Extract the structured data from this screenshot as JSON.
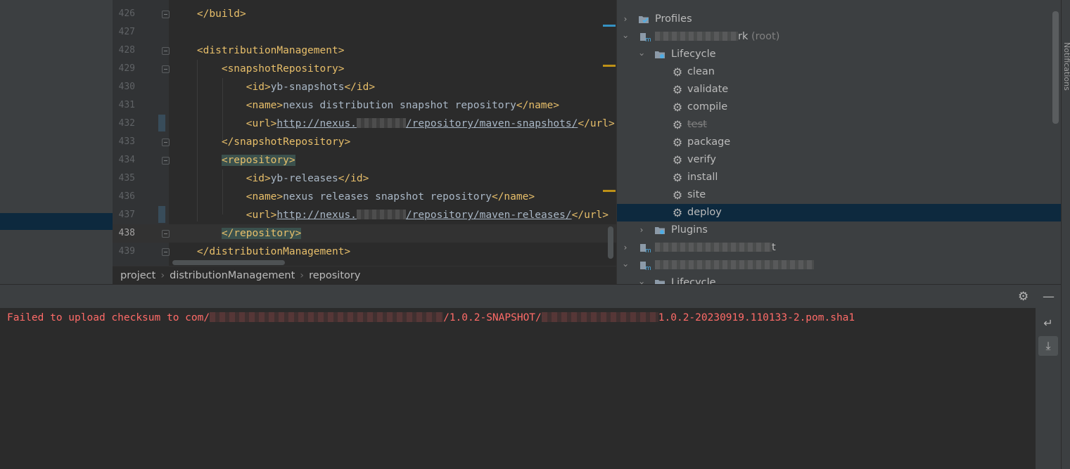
{
  "editor": {
    "lines": [
      {
        "num": "426",
        "segments": [
          {
            "c": "    "
          },
          {
            "c": "</build>"
          }
        ]
      },
      {
        "num": "427",
        "segments": []
      },
      {
        "num": "428",
        "segments": [
          {
            "c": "    "
          },
          {
            "c": "<distributionManagement>"
          }
        ]
      },
      {
        "num": "429",
        "segments": [
          {
            "c": "        "
          },
          {
            "c": "<snapshotRepository>"
          }
        ]
      },
      {
        "num": "430",
        "segments": [
          {
            "c": "            "
          },
          {
            "c": "<id>"
          },
          {
            "t": "yb-snapshots"
          },
          {
            "c": "</id>"
          }
        ]
      },
      {
        "num": "431",
        "segments": [
          {
            "c": "            "
          },
          {
            "c": "<name>"
          },
          {
            "t": "nexus distribution snapshot repository"
          },
          {
            "c": "</name>"
          }
        ]
      },
      {
        "num": "432",
        "segments": [
          {
            "c": "            "
          },
          {
            "c": "<url>"
          },
          {
            "u": "http://nexus."
          },
          {
            "r": "1"
          },
          {
            "u": "/repository/maven-snapshots/"
          },
          {
            "c": "</url>"
          }
        ]
      },
      {
        "num": "433",
        "segments": [
          {
            "c": "        "
          },
          {
            "c": "</snapshotRepository>"
          }
        ]
      },
      {
        "num": "434",
        "segments": [
          {
            "c": "        "
          },
          {
            "h": "<repository>"
          }
        ]
      },
      {
        "num": "435",
        "segments": [
          {
            "c": "            "
          },
          {
            "c": "<id>"
          },
          {
            "t": "yb-releases"
          },
          {
            "c": "</id>"
          }
        ]
      },
      {
        "num": "436",
        "segments": [
          {
            "c": "            "
          },
          {
            "c": "<name>"
          },
          {
            "t": "nexus releases snapshot repository"
          },
          {
            "c": "</name>"
          }
        ]
      },
      {
        "num": "437",
        "segments": [
          {
            "c": "            "
          },
          {
            "c": "<url>"
          },
          {
            "u": "http://nexus."
          },
          {
            "r": "1"
          },
          {
            "u": "/repository/maven-releases/"
          },
          {
            "c": "</url>"
          }
        ]
      },
      {
        "num": "438",
        "segments": [
          {
            "c": "        "
          },
          {
            "h": "</repository>"
          }
        ],
        "current": true
      },
      {
        "num": "439",
        "segments": [
          {
            "c": "    "
          },
          {
            "c": "</distributionManagement>"
          }
        ]
      }
    ]
  },
  "breadcrumb": [
    "project",
    "distributionManagement",
    "repository"
  ],
  "maven": {
    "profiles_label": "Profiles",
    "root_suffix": "rk",
    "root_tag": "(root)",
    "lifecycle_label": "Lifecycle",
    "goals": [
      "clean",
      "validate",
      "compile",
      "test",
      "package",
      "verify",
      "install",
      "site",
      "deploy"
    ],
    "skipped_goal": "test",
    "selected_goal": "deploy",
    "plugins_label": "Plugins",
    "module2_suffix": "t",
    "module3_suffix": "",
    "lifecycle2_label": "Lifecycle"
  },
  "console": {
    "error_prefix": "Failed to upload checksum to com/",
    "error_mid": "/1.0.2-SNAPSHOT/",
    "error_suffix": "1.0.2-20230919.110133-2.pom.sha1"
  },
  "side_strip_label": "Notifications",
  "colors": {
    "error": "#ff6b68",
    "tag": "#e8bf6a",
    "selection": "#0d293e"
  }
}
